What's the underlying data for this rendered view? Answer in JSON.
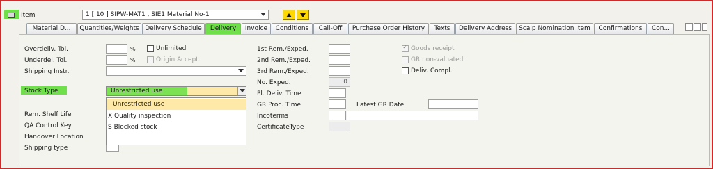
{
  "colors": {
    "highlight": "#6fe04a",
    "frame_border": "#cc2b2b",
    "nav_button": "#ffd800",
    "selected_option": "#ffe9a8"
  },
  "header": {
    "item_label": "Item",
    "item_select_value": "1 [ 10 ] SIPW-MAT1 , SIE1 Material No-1",
    "icons": [
      "item-overview-icon",
      "chevron-down-icon",
      "arrow-up-icon",
      "arrow-down-icon"
    ]
  },
  "tabs": [
    {
      "label": "Material D..."
    },
    {
      "label": "Quantities/Weights"
    },
    {
      "label": "Delivery Schedule"
    },
    {
      "label": "Delivery",
      "active": true
    },
    {
      "label": "Invoice"
    },
    {
      "label": "Conditions"
    },
    {
      "label": "Call-Off"
    },
    {
      "label": "Purchase Order History"
    },
    {
      "label": "Texts"
    },
    {
      "label": "Delivery Address"
    },
    {
      "label": "Scalp Nomination Item"
    },
    {
      "label": "Confirmations"
    },
    {
      "label": "Con..."
    }
  ],
  "left": {
    "overdeliv_label": "Overdeliv. Tol.",
    "underdel_label": "Underdel. Tol.",
    "percent": "%",
    "unlimited_label": "Unlimited",
    "origin_accept_label": "Origin Accept.",
    "shipping_instr_label": "Shipping Instr.",
    "stock_type_label": "Stock Type",
    "stock_type_value": "Unrestricted use",
    "rem_shelf_life_label": "Rem. Shelf Life",
    "qa_control_key_label": "QA Control Key",
    "handover_location_label": "Handover Location",
    "shipping_type_label": "Shipping type"
  },
  "stock_type_options": [
    "Unrestricted use",
    "X Quality inspection",
    "S Blocked stock"
  ],
  "middle": {
    "rem1_label": "1st Rem./Exped.",
    "rem2_label": "2nd Rem./Exped.",
    "rem3_label": "3rd Rem./Exped.",
    "no_exped_label": "No. Exped.",
    "no_exped_value": "0",
    "pl_deliv_time_label": "Pl. Deliv. Time",
    "gr_proc_time_label": "GR Proc. Time",
    "latest_gr_date_label": "Latest GR Date",
    "incoterms_label": "Incoterms",
    "certificate_type_label": "CertificateType"
  },
  "right": {
    "goods_receipt_label": "Goods receipt",
    "gr_non_valuated_label": "GR non-valuated",
    "deliv_compl_label": "Deliv. Compl."
  }
}
